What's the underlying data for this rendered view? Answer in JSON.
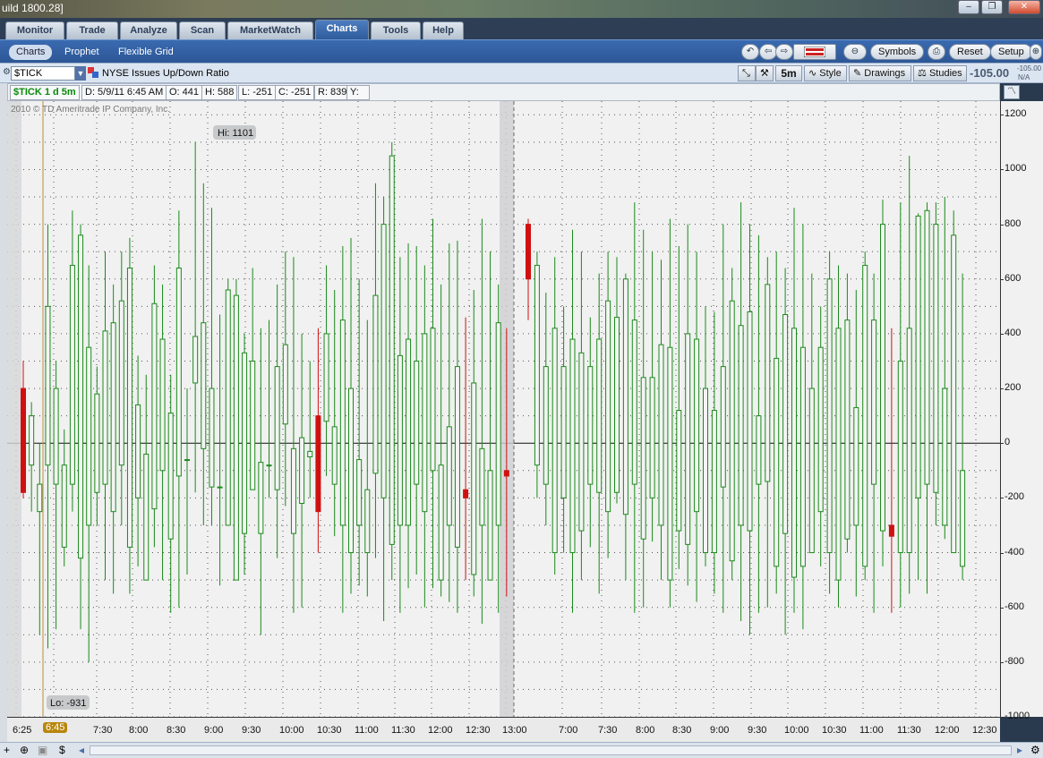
{
  "window": {
    "title": "uild 1800.28]",
    "buttons": [
      "–",
      "❐",
      "✕"
    ]
  },
  "main_tabs": [
    "Monitor",
    "Trade",
    "Analyze",
    "Scan",
    "MarketWatch",
    "Charts",
    "Tools",
    "Help"
  ],
  "active_main_tab": "Charts",
  "sub_tabs": [
    "Charts",
    "Prophet",
    "Flexible Grid"
  ],
  "toolbar": {
    "symbols_label": "Symbols",
    "reset_label": "Reset",
    "setup_label": "Setup"
  },
  "symbol_row": {
    "symbol": "$TICK",
    "description": "NYSE Issues Up/Down Ratio",
    "timeframe": "5m",
    "style_label": "Style",
    "drawings_label": "Drawings",
    "studies_label": "Studies",
    "last": "-105.00",
    "last_small": "-105.00",
    "change": "N/A"
  },
  "info_row": {
    "symbol_period": "$TICK 1 d 5m",
    "date": "D: 5/9/11 6:45 AM",
    "open": "O: 441",
    "high": "H: 588",
    "low": "L: -251",
    "close": "C: -251",
    "range": "R: 839",
    "y": "Y:"
  },
  "chart_labels": {
    "copyright": "2010 © TD Ameritrade IP Company, Inc.",
    "hi": "Hi: 1101",
    "lo": "Lo: -931",
    "cursor_time": "6:45"
  },
  "colors": {
    "up": "#1c8a1c",
    "down": "#d01010",
    "background": "#f0f1f0",
    "accent": "#2e5c9c"
  },
  "chart_data": {
    "type": "candlestick",
    "title": "$TICK 1 d 5m",
    "ylim": [
      -1000,
      1250
    ],
    "y_ticks": [
      1200,
      1000,
      800,
      600,
      400,
      200,
      0,
      -200,
      -400,
      -600,
      -800,
      -1000
    ],
    "x_ticks": [
      "6:25",
      "6:45",
      "7:30",
      "8:00",
      "8:30",
      "9:00",
      "9:30",
      "10:00",
      "10:30",
      "11:00",
      "11:30",
      "12:00",
      "12:30",
      "13:00",
      "7:00",
      "7:30",
      "8:00",
      "8:30",
      "9:00",
      "9:30",
      "10:00",
      "10:30",
      "11:00",
      "11:30",
      "12:00",
      "12:30"
    ],
    "grid": true,
    "zero_line": true,
    "session_break": "13:00",
    "high": 1101,
    "low": -931,
    "candles_day1": [
      [
        200,
        -180,
        300,
        -200
      ],
      [
        -80,
        100,
        150,
        -250
      ],
      [
        -250,
        -150,
        0,
        -700
      ],
      [
        -80,
        500,
        800,
        -750
      ],
      [
        -150,
        200,
        300,
        -680
      ],
      [
        -380,
        -80,
        50,
        -450
      ],
      [
        -150,
        650,
        850,
        -250
      ],
      [
        -420,
        760,
        800,
        -680
      ],
      [
        -300,
        350,
        650,
        -800
      ],
      [
        -180,
        180,
        280,
        -300
      ],
      [
        -150,
        410,
        700,
        -500
      ],
      [
        -250,
        440,
        580,
        -550
      ],
      [
        -80,
        520,
        700,
        -300
      ],
      [
        -380,
        640,
        750,
        -550
      ],
      [
        -200,
        140,
        320,
        -450
      ],
      [
        -500,
        -40,
        250,
        -480
      ],
      [
        -240,
        510,
        650,
        -380
      ],
      [
        -100,
        380,
        580,
        -500
      ],
      [
        -350,
        110,
        250,
        -620
      ],
      [
        -120,
        640,
        850,
        -600
      ],
      [
        -60,
        -60,
        200,
        -480
      ],
      [
        220,
        390,
        1100,
        -180
      ],
      [
        -20,
        440,
        950,
        -300
      ],
      [
        -160,
        200,
        860,
        -300
      ],
      [
        -160,
        -160,
        470,
        -520
      ],
      [
        -300,
        560,
        600,
        -220
      ],
      [
        -500,
        540,
        600,
        -380
      ],
      [
        -330,
        330,
        400,
        -480
      ],
      [
        -170,
        300,
        640,
        -100
      ],
      [
        -330,
        -70,
        420,
        -700
      ],
      [
        -80,
        -80,
        450,
        -200
      ],
      [
        -170,
        280,
        580,
        -420
      ],
      [
        70,
        360,
        700,
        -230
      ],
      [
        -330,
        -20,
        680,
        -620
      ],
      [
        -220,
        20,
        400,
        -600
      ],
      [
        -50,
        -30,
        300,
        -200
      ],
      [
        100,
        -250,
        420,
        -400
      ],
      [
        80,
        400,
        650,
        -120
      ],
      [
        -150,
        60,
        560,
        -340
      ],
      [
        -300,
        450,
        720,
        -620
      ],
      [
        -400,
        200,
        750,
        -550
      ],
      [
        -300,
        -60,
        600,
        -520
      ],
      [
        -400,
        -170,
        450,
        -560
      ],
      [
        -110,
        540,
        950,
        -420
      ],
      [
        -200,
        800,
        900,
        -650
      ],
      [
        -370,
        1050,
        1100,
        -500
      ],
      [
        -300,
        320,
        680,
        -620
      ],
      [
        -300,
        380,
        730,
        -530
      ],
      [
        -150,
        300,
        720,
        -480
      ],
      [
        -250,
        400,
        650,
        -600
      ],
      [
        -100,
        420,
        820,
        -530
      ],
      [
        -500,
        -80,
        580,
        -560
      ],
      [
        -300,
        60,
        730,
        -580
      ],
      [
        -380,
        280,
        740,
        -620
      ],
      [
        -170,
        -200,
        460,
        -500
      ],
      [
        -480,
        220,
        560,
        -560
      ],
      [
        -300,
        -20,
        820,
        -660
      ],
      [
        -500,
        -100,
        700,
        -420
      ],
      [
        -300,
        440,
        580,
        -620
      ],
      [
        -100,
        -120,
        420,
        -560
      ]
    ],
    "candles_day2": [
      [
        800,
        600,
        820,
        450
      ],
      [
        -80,
        650,
        700,
        -200
      ],
      [
        -150,
        280,
        550,
        -300
      ],
      [
        -400,
        420,
        680,
        -480
      ],
      [
        -200,
        280,
        500,
        -400
      ],
      [
        -400,
        380,
        780,
        -620
      ],
      [
        -320,
        330,
        700,
        -500
      ],
      [
        -150,
        280,
        460,
        -380
      ],
      [
        -180,
        380,
        620,
        -550
      ],
      [
        -250,
        520,
        700,
        -420
      ],
      [
        -180,
        460,
        680,
        -220
      ],
      [
        -260,
        600,
        620,
        -500
      ],
      [
        -150,
        450,
        880,
        -620
      ],
      [
        -350,
        240,
        780,
        -600
      ],
      [
        -200,
        240,
        700,
        -360
      ],
      [
        -300,
        360,
        670,
        -500
      ],
      [
        -500,
        350,
        820,
        -600
      ],
      [
        -320,
        120,
        720,
        -460
      ],
      [
        -370,
        400,
        800,
        -520
      ],
      [
        -250,
        380,
        700,
        -580
      ],
      [
        -400,
        200,
        500,
        -450
      ],
      [
        -400,
        120,
        480,
        -550
      ],
      [
        -160,
        280,
        800,
        -620
      ],
      [
        -430,
        520,
        640,
        -500
      ],
      [
        -300,
        430,
        880,
        -650
      ],
      [
        -320,
        480,
        800,
        -700
      ],
      [
        -150,
        100,
        760,
        -620
      ],
      [
        -140,
        580,
        680,
        -600
      ],
      [
        -450,
        310,
        700,
        -550
      ],
      [
        -330,
        470,
        640,
        -700
      ],
      [
        -490,
        420,
        860,
        -620
      ],
      [
        -450,
        350,
        800,
        -680
      ],
      [
        -400,
        200,
        620,
        -400
      ],
      [
        -250,
        350,
        500,
        -450
      ],
      [
        -400,
        600,
        700,
        -550
      ],
      [
        -500,
        420,
        650,
        -600
      ],
      [
        -350,
        450,
        620,
        -400
      ],
      [
        -300,
        130,
        560,
        -560
      ],
      [
        -450,
        650,
        700,
        -500
      ],
      [
        -150,
        450,
        620,
        -620
      ],
      [
        -320,
        800,
        890,
        -450
      ],
      [
        -300,
        -340,
        420,
        -620
      ],
      [
        -400,
        300,
        880,
        -600
      ],
      [
        -400,
        420,
        1050,
        -550
      ],
      [
        -200,
        830,
        840,
        -500
      ],
      [
        -150,
        850,
        880,
        -550
      ],
      [
        -180,
        800,
        880,
        -300
      ],
      [
        -300,
        200,
        900,
        -350
      ],
      [
        -400,
        760,
        850,
        -400
      ],
      [
        -450,
        -100,
        620,
        -500
      ]
    ]
  },
  "bottom": {
    "glyphs": [
      "+",
      "⊕",
      "▣",
      "$",
      "◂",
      "▸"
    ]
  }
}
